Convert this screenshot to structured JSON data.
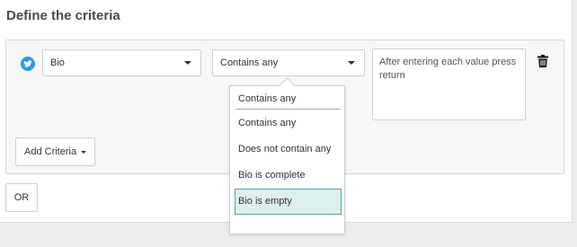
{
  "header": {
    "title": "Define the criteria"
  },
  "criteria": {
    "source_icon": "twitter-bird-icon",
    "field_select": {
      "value": "Bio"
    },
    "operator_select": {
      "value": "Contains any"
    },
    "value_input": {
      "placeholder": "After entering each value press return"
    },
    "delete_icon": "trash-icon",
    "add_criteria_label": "Add Criteria"
  },
  "or_button_label": "OR",
  "dropdown": {
    "search_value": "Contains any",
    "options": [
      {
        "label": "Contains any",
        "active": false
      },
      {
        "label": "Does not contain any",
        "active": false
      },
      {
        "label": "Bio is complete",
        "active": false
      },
      {
        "label": "Bio is empty",
        "active": true
      }
    ]
  },
  "colors": {
    "twitter_blue": "#2c9de3",
    "highlight_bg": "#ddf0ee",
    "highlight_border": "#4ea99a"
  }
}
